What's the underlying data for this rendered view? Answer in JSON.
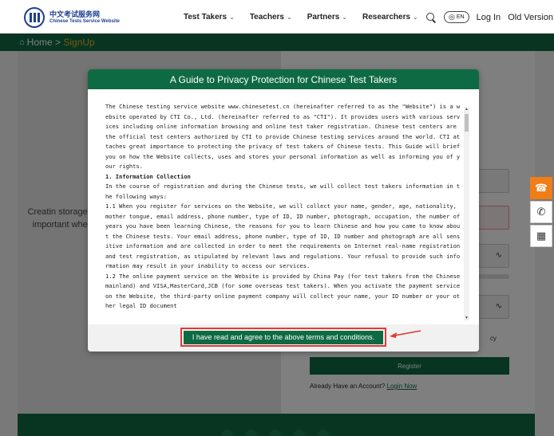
{
  "header": {
    "logo_cn": "中文考试服务网",
    "logo_en": "Chinese Tests Service Website",
    "nav": [
      {
        "label": "Test Takers"
      },
      {
        "label": "Teachers"
      },
      {
        "label": "Partners"
      },
      {
        "label": "Researchers"
      }
    ],
    "lang": "EN",
    "login": "Log In",
    "old_version": "Old Version"
  },
  "breadcrumb": {
    "home": "Home",
    "sep": " > ",
    "current": "SignUp"
  },
  "page": {
    "left_text": "Creatin storage of important whene",
    "policy_tail": "cy",
    "register": "Register",
    "have_account": "Already Have an Account?",
    "login_now": "Login Now"
  },
  "modal": {
    "title": "A Guide to Privacy Protection for Chinese Test Takers",
    "paragraphs": [
      "The Chinese testing service website www.chinesetest.cn (hereinafter referred to as the \"Website\") is a website operated by CTI Co., Ltd. (hereinafter referred to as \"CTI\"). It provides users with various services including online information browsing and online test taker registration. Chinese test centers are the official test centers authorized by CTI to provide Chinese testing services around the world. CTI attaches great importance to protecting the privacy of test takers of Chinese tests. This Guide will brief you on how the Website collects, uses and stores your personal information as well as informing you of your rights.",
      "1. Information Collection",
      "In the course of registration and during the Chinese tests, we will collect test takers information in the following ways:",
      "1.1 When you register for services on the Website, we will collect your name, gender, age, nationality, mother tongue, email address, phone number, type of ID, ID number, photograph, occupation, the number of years you have been learning Chinese, the reasons for you to learn Chinese and how you came to know about the Chinese tests. Your email address, phone number, type of ID, ID number and photograph are all sensitive information and are collected in order to meet the requirements on Internet real-name registration and test registration, as stipulated by relevant laws and regulations. Your refusal to provide such information may result in your inability to access our services.",
      "1.2 The online payment service on the Website is provided by China Pay (for test takers from the Chinese mainland) and VISA,MasterCard,JCB (for some overseas test takers). When you activate the payment service on the Website, the third-party online payment company will collect your name, your ID number or your other legal ID document"
    ],
    "agree": "I have read and agree to the above terms and conditions."
  },
  "colors": {
    "brand_green": "#0e6a42",
    "accent_orange": "#f07d16",
    "breadcrumb_current": "#f0b323",
    "highlight_red": "#e23838"
  }
}
